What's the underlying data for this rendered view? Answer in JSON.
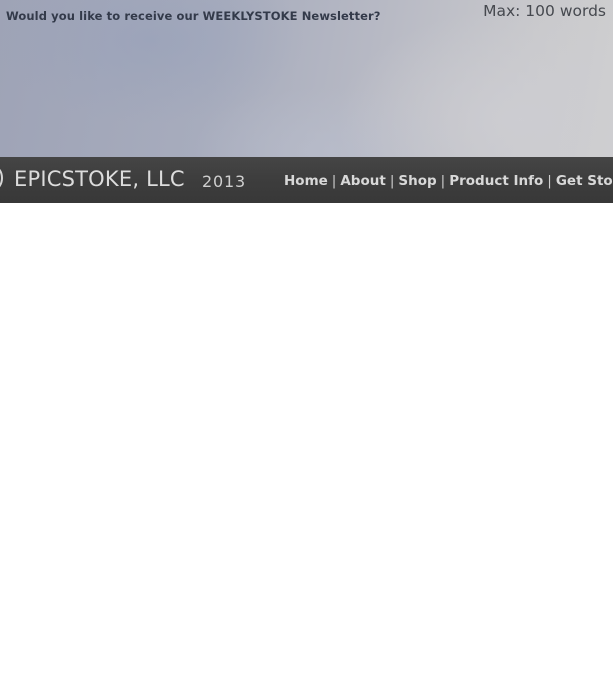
{
  "newsletter": {
    "question": "Would you like to receive our WEEKLYSTOKE Newsletter?",
    "max_words": "Max: 100 words"
  },
  "footer": {
    "brand_name": "EPICSTOKE, LLC",
    "year": "2013",
    "separator": "|",
    "nav": [
      {
        "label": "Home"
      },
      {
        "label": "About"
      },
      {
        "label": "Shop"
      },
      {
        "label": "Product Info"
      },
      {
        "label": "Get Stoked"
      }
    ]
  }
}
